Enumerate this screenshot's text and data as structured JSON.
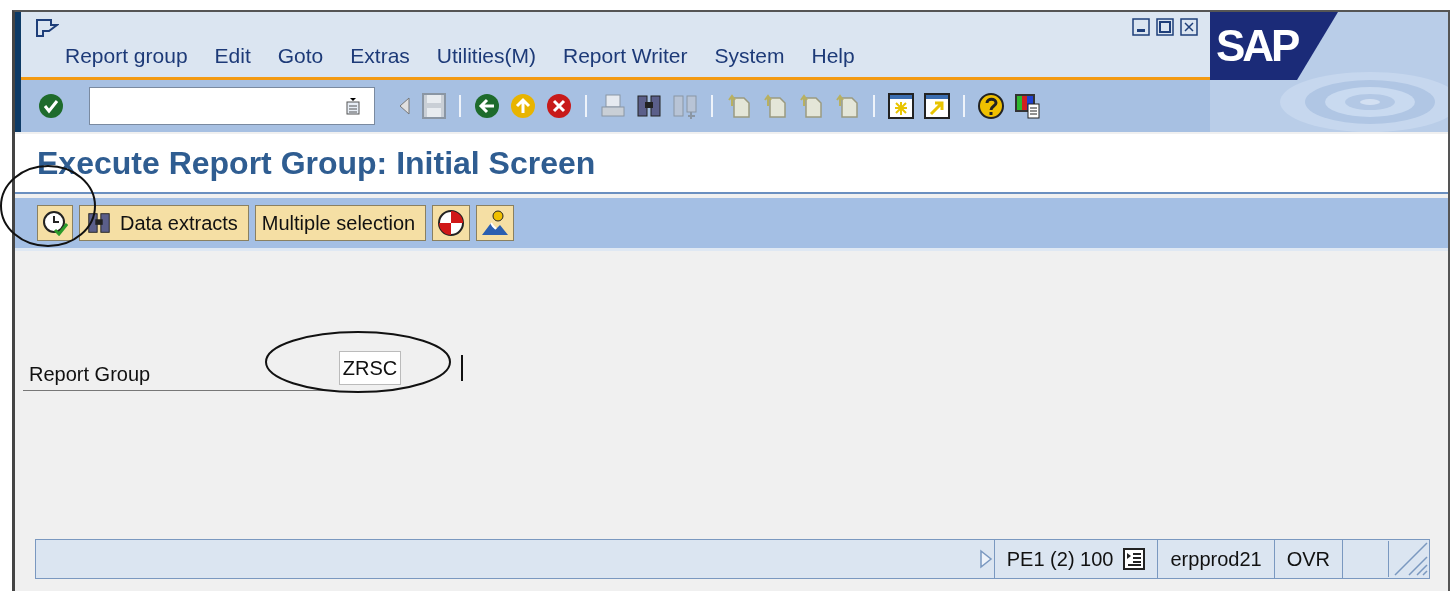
{
  "menu": [
    {
      "label": "Report group"
    },
    {
      "label": "Edit"
    },
    {
      "label": "Goto"
    },
    {
      "label": "Extras"
    },
    {
      "label": "Utilities(M)"
    },
    {
      "label": "Report Writer"
    },
    {
      "label": "System"
    },
    {
      "label": "Help"
    }
  ],
  "logo": "SAP",
  "title": "Execute Report Group: Initial Screen",
  "app_toolbar": [
    {
      "label": "Data extracts"
    },
    {
      "label": "Multiple selection"
    }
  ],
  "fields": [
    {
      "label": "Report Group",
      "value": "ZRSC"
    }
  ],
  "status_bar": {
    "system": "PE1 (2) 100",
    "server": "erpprod21",
    "mode": "OVR"
  }
}
